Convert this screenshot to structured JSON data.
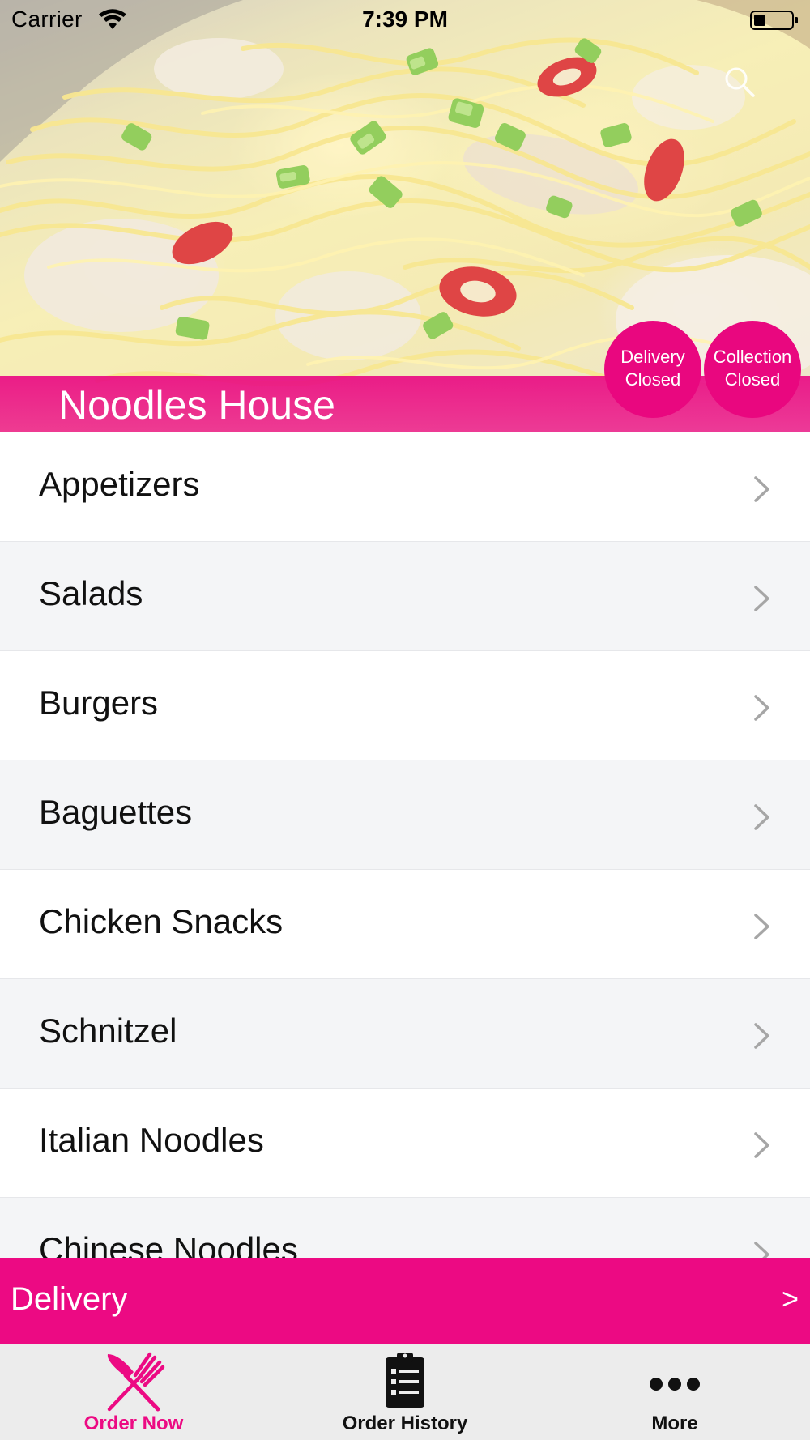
{
  "status_bar": {
    "carrier": "Carrier",
    "time": "7:39 PM"
  },
  "hero": {
    "restaurant_name": "Noodles House",
    "badges": {
      "delivery": {
        "line1": "Delivery",
        "line2": "Closed"
      },
      "collection": {
        "line1": "Collection",
        "line2": "Closed"
      }
    }
  },
  "menu": {
    "items": [
      {
        "label": "Appetizers"
      },
      {
        "label": "Salads"
      },
      {
        "label": "Burgers"
      },
      {
        "label": "Baguettes"
      },
      {
        "label": "Chicken Snacks"
      },
      {
        "label": "Schnitzel"
      },
      {
        "label": "Italian Noodles"
      },
      {
        "label": "Chinese Noodles"
      }
    ]
  },
  "order_mode": {
    "label": "Delivery",
    "arrow": ">"
  },
  "tab_bar": {
    "tabs": [
      {
        "label": "Order Now",
        "icon": "fork-knife-icon",
        "active": true
      },
      {
        "label": "Order History",
        "icon": "clipboard-list-icon",
        "active": false
      },
      {
        "label": "More",
        "icon": "more-dots-icon",
        "active": false
      }
    ]
  },
  "colors": {
    "accent": "#ec0a83",
    "row_alt": "#f4f5f7",
    "tab_bar_bg": "#ececec"
  }
}
